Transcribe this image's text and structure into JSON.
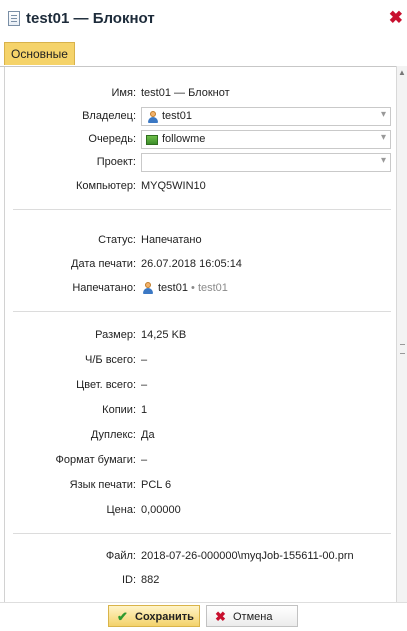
{
  "window": {
    "title": "test01 — Блокнот",
    "close_glyph": "✖"
  },
  "tabs": [
    {
      "label": "Основные",
      "active": true
    }
  ],
  "general": {
    "name": {
      "label": "Имя:",
      "value": "test01 — Блокнот"
    },
    "owner": {
      "label": "Владелец:",
      "value": "test01",
      "icon": "user-icon"
    },
    "queue": {
      "label": "Очередь:",
      "value": "followme",
      "icon": "printer-queue-icon"
    },
    "project": {
      "label": "Проект:",
      "value": ""
    },
    "computer": {
      "label": "Компьютер:",
      "value": "MYQ5WIN10"
    }
  },
  "print": {
    "status": {
      "label": "Статус:",
      "value": "Напечатано"
    },
    "print_date": {
      "label": "Дата печати:",
      "value": "26.07.2018 16:05:14"
    },
    "printed_by": {
      "label": "Напечатано:",
      "user": "test01",
      "separator": "•",
      "secondary": "test01"
    }
  },
  "details": {
    "size": {
      "label": "Размер:",
      "value": "14,25 KB"
    },
    "bw_total": {
      "label": "Ч/Б всего:",
      "value": "–"
    },
    "color_total": {
      "label": "Цвет. всего:",
      "value": "–"
    },
    "copies": {
      "label": "Копии:",
      "value": "1"
    },
    "duplex": {
      "label": "Дуплекс:",
      "value": "Да"
    },
    "paper_format": {
      "label": "Формат бумаги:",
      "value": "–"
    },
    "print_language": {
      "label": "Язык печати:",
      "value": "PCL 6"
    },
    "price": {
      "label": "Цена:",
      "value": "0,00000"
    }
  },
  "file": {
    "file": {
      "label": "Файл:",
      "value": "2018-07-26-000000\\myqJob-155611-00.prn"
    },
    "id": {
      "label": "ID:",
      "value": "882"
    }
  },
  "footer": {
    "save_label": "Сохранить",
    "save_icon": "✔",
    "cancel_label": "Отмена",
    "cancel_icon": "✖"
  },
  "colors": {
    "tab_active": "#f5d36a",
    "save_button": "#f3d26b",
    "close": "#c8102e"
  }
}
